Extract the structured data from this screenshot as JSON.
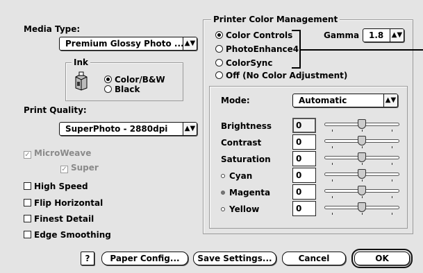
{
  "media_type": {
    "label": "Media Type:",
    "value": "Premium Glossy Photo ..."
  },
  "ink": {
    "title": "Ink",
    "options": [
      "Color/B&W",
      "Black"
    ],
    "selected": 0
  },
  "print_quality": {
    "label": "Print Quality:",
    "value": "SuperPhoto - 2880dpi"
  },
  "options": {
    "microweave": {
      "label": "MicroWeave",
      "checked": true,
      "enabled": false
    },
    "super": {
      "label": "Super",
      "checked": true,
      "enabled": false
    },
    "high_speed": {
      "label": "High Speed",
      "checked": false
    },
    "flip_horizontal": {
      "label": "Flip Horizontal",
      "checked": false
    },
    "finest_detail": {
      "label": "Finest Detail",
      "checked": false
    },
    "edge_smoothing": {
      "label": "Edge Smoothing",
      "checked": false
    }
  },
  "color_management": {
    "title": "Printer Color Management",
    "radios": [
      "Color Controls",
      "PhotoEnhance4",
      "ColorSync",
      "Off (No Color Adjustment)"
    ],
    "selected": 0,
    "gamma_label": "Gamma",
    "gamma_value": "1.8"
  },
  "controls": {
    "mode_label": "Mode:",
    "mode_value": "Automatic",
    "rows": [
      {
        "label": "Brightness",
        "value": "0",
        "marker": "none",
        "level": 0.5
      },
      {
        "label": "Contrast",
        "value": "0",
        "marker": "none",
        "level": 0.5
      },
      {
        "label": "Saturation",
        "value": "0",
        "marker": "none",
        "level": 0.5
      },
      {
        "label": "Cyan",
        "value": "0",
        "marker": "hollow",
        "level": 0.5
      },
      {
        "label": "Magenta",
        "value": "0",
        "marker": "gray",
        "level": 0.5
      },
      {
        "label": "Yellow",
        "value": "0",
        "marker": "hollow",
        "level": 0.5
      }
    ]
  },
  "buttons": {
    "help": "?",
    "paper_config": "Paper Config...",
    "save_settings": "Save Settings...",
    "cancel": "Cancel",
    "ok": "OK"
  },
  "icons": {
    "ink": "ink-cartridge-icon",
    "help": "question-mark-icon",
    "popup_arrow": "up-down-arrows-icon"
  }
}
